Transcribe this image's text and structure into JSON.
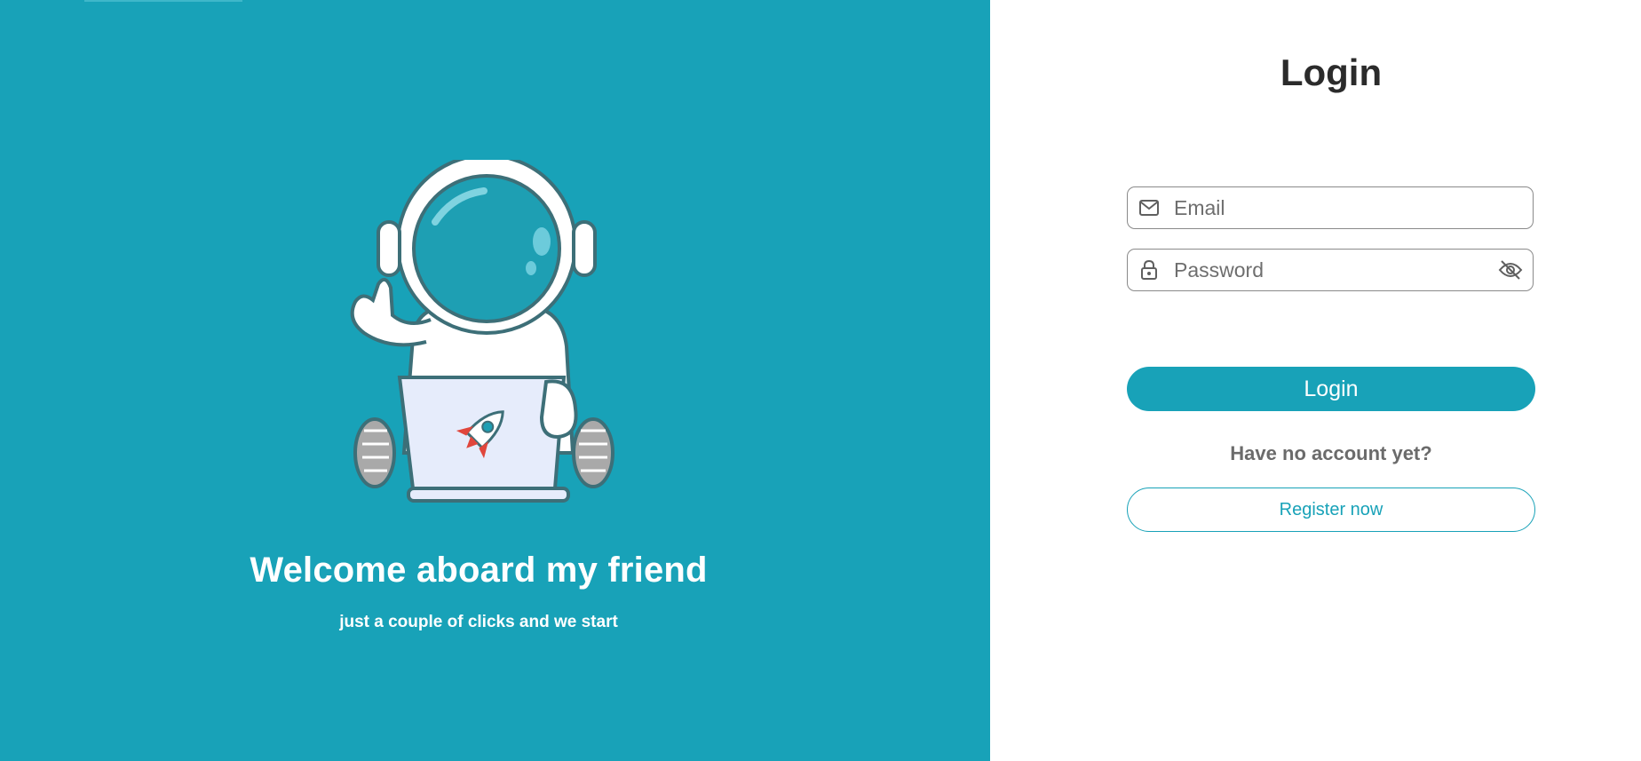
{
  "hero": {
    "title": "Welcome aboard my friend",
    "subtitle": "just a couple of clicks and we start",
    "illustration": "astronaut-with-laptop",
    "background_color": "#18a2b8"
  },
  "login": {
    "title": "Login",
    "email": {
      "placeholder": "Email",
      "value": "",
      "icon": "envelope-icon"
    },
    "password": {
      "placeholder": "Password",
      "value": "",
      "icon": "lock-icon",
      "toggle_icon": "eye-slash-icon"
    },
    "submit_label": "Login",
    "no_account_text": "Have no account yet?",
    "register_label": "Register now",
    "accent_color": "#18a2b8"
  }
}
